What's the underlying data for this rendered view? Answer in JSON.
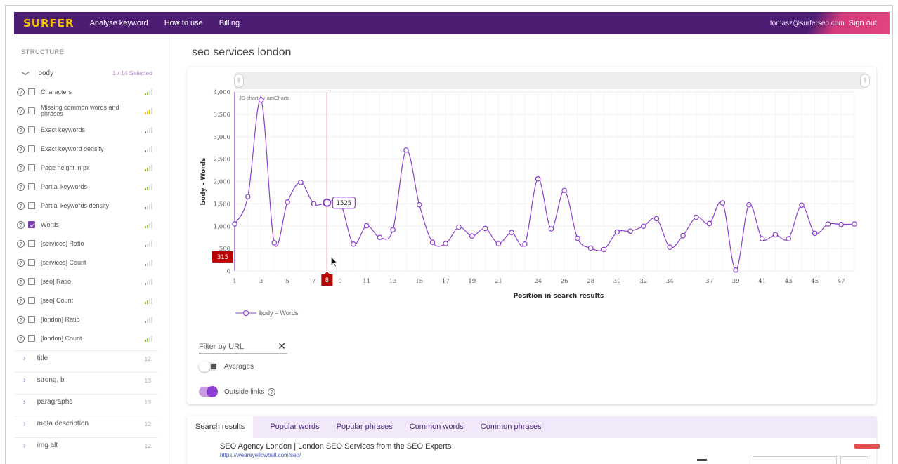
{
  "header": {
    "logo": "SURFER",
    "nav": [
      "Analyse keyword",
      "How to use",
      "Billing"
    ],
    "email": "tomasz@surferseo.com",
    "sign_out": "Sign out"
  },
  "sidebar": {
    "title": "STRUCTURE",
    "section": {
      "label": "body",
      "selected": "1 / 14 Selected"
    },
    "items": [
      {
        "label": "Characters",
        "checked": false,
        "bars": "g"
      },
      {
        "label": "Missing common words and phrases",
        "checked": false,
        "bars": "y"
      },
      {
        "label": "Exact keywords",
        "checked": false,
        "bars": "n"
      },
      {
        "label": "Exact keyword density",
        "checked": false,
        "bars": "n"
      },
      {
        "label": "Page height in px",
        "checked": false,
        "bars": "g"
      },
      {
        "label": "Partial keywords",
        "checked": false,
        "bars": "g"
      },
      {
        "label": "Partial keywords density",
        "checked": false,
        "bars": "n"
      },
      {
        "label": "Words",
        "checked": true,
        "bars": "g"
      },
      {
        "label": "[services] Ratio",
        "checked": false,
        "bars": "n"
      },
      {
        "label": "[services] Count",
        "checked": false,
        "bars": "n"
      },
      {
        "label": "[seo] Ratio",
        "checked": false,
        "bars": "n"
      },
      {
        "label": "[seo] Count",
        "checked": false,
        "bars": "g"
      },
      {
        "label": "[london] Ratio",
        "checked": false,
        "bars": "n"
      },
      {
        "label": "[london] Count",
        "checked": false,
        "bars": "g"
      }
    ],
    "groups": [
      {
        "label": "title",
        "count": "12"
      },
      {
        "label": "strong, b",
        "count": "13"
      },
      {
        "label": "paragraphs",
        "count": "13"
      },
      {
        "label": "meta description",
        "count": "12"
      },
      {
        "label": "img alt",
        "count": "12"
      }
    ]
  },
  "main": {
    "title": "seo services london",
    "filter_placeholder": "Filter by URL",
    "averages_label": "Averages",
    "outside_links_label": "Outside links"
  },
  "chart_data": {
    "type": "line",
    "credit": "JS chart by amCharts",
    "xlabel": "Position in search results",
    "ylabel": "body – Words",
    "ylim": [
      0,
      4000
    ],
    "yticks": [
      0,
      500,
      1000,
      1500,
      2000,
      2500,
      3000,
      3500,
      4000
    ],
    "ytick_labels": [
      "0",
      "500",
      "1,000",
      "1,500",
      "2,000",
      "2,500",
      "3,000",
      "3,500",
      "4,000"
    ],
    "xlim": [
      1,
      48
    ],
    "xtick_labels": [
      "1",
      "3",
      "5",
      "7",
      "8",
      "9",
      "11",
      "13",
      "15",
      "17",
      "19",
      "21",
      "24",
      "26",
      "28",
      "30",
      "32",
      "34",
      "37",
      "39",
      "41",
      "43",
      "45",
      "47"
    ],
    "series": [
      {
        "name": "body – Words",
        "x": [
          1,
          2,
          3,
          4,
          5,
          6,
          7,
          8,
          9,
          10,
          11,
          12,
          13,
          14,
          15,
          16,
          17,
          18,
          19,
          20,
          21,
          22,
          23,
          24,
          25,
          26,
          27,
          28,
          29,
          30,
          31,
          32,
          33,
          34,
          35,
          36,
          37,
          38,
          39,
          40,
          41,
          42,
          43,
          44,
          45,
          46,
          47,
          48
        ],
        "y": [
          1050,
          1660,
          3820,
          630,
          1540,
          1980,
          1500,
          1525,
          1530,
          600,
          1010,
          750,
          920,
          2700,
          1480,
          640,
          610,
          980,
          780,
          950,
          610,
          860,
          600,
          2060,
          940,
          1800,
          730,
          510,
          480,
          870,
          890,
          1000,
          1170,
          530,
          790,
          1200,
          1060,
          1520,
          20,
          1480,
          720,
          810,
          720,
          1470,
          840,
          1050,
          1040,
          1050
        ]
      }
    ],
    "cursor": {
      "x_label": "8",
      "y_label": "315",
      "value_label": "1525"
    },
    "legend": "body – Words",
    "legend_position": "bottom-left"
  },
  "tabs": [
    "Search results",
    "Popular words",
    "Popular phrases",
    "Common words",
    "Common phrases"
  ],
  "result": {
    "title": "SEO Agency London | London SEO Services from the SEO Experts",
    "url": "https://weareyellowball.com/seo/"
  },
  "colors": {
    "header": "#4c1d73",
    "accent": "#8b3fd0",
    "line": "#8b3fd0",
    "cursor": "#b80000"
  }
}
